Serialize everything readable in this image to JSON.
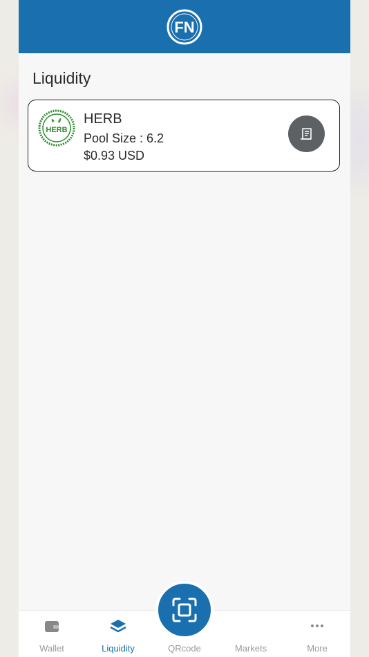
{
  "header": {
    "logo_text": "FN"
  },
  "page": {
    "title": "Liquidity"
  },
  "pools": [
    {
      "symbol": "HERB",
      "logo_text": "HERB",
      "pool_size": "Pool Size : 6.2",
      "value": "$0.93 USD",
      "detail_icon": "receipt-icon"
    }
  ],
  "nav": {
    "items": [
      {
        "label": "Wallet",
        "icon": "wallet-icon",
        "active": false
      },
      {
        "label": "Liquidity",
        "icon": "layers-icon",
        "active": true
      },
      {
        "label": "QRcode",
        "icon": "scan-icon",
        "active": false
      },
      {
        "label": "Markets",
        "icon": "",
        "active": false
      },
      {
        "label": "More",
        "icon": "more-icon",
        "active": false
      }
    ]
  },
  "colors": {
    "brand": "#1a6fae",
    "inactive": "#9a9a9a",
    "button_dark": "#5d6163",
    "herb_green": "#2e8b2e"
  }
}
